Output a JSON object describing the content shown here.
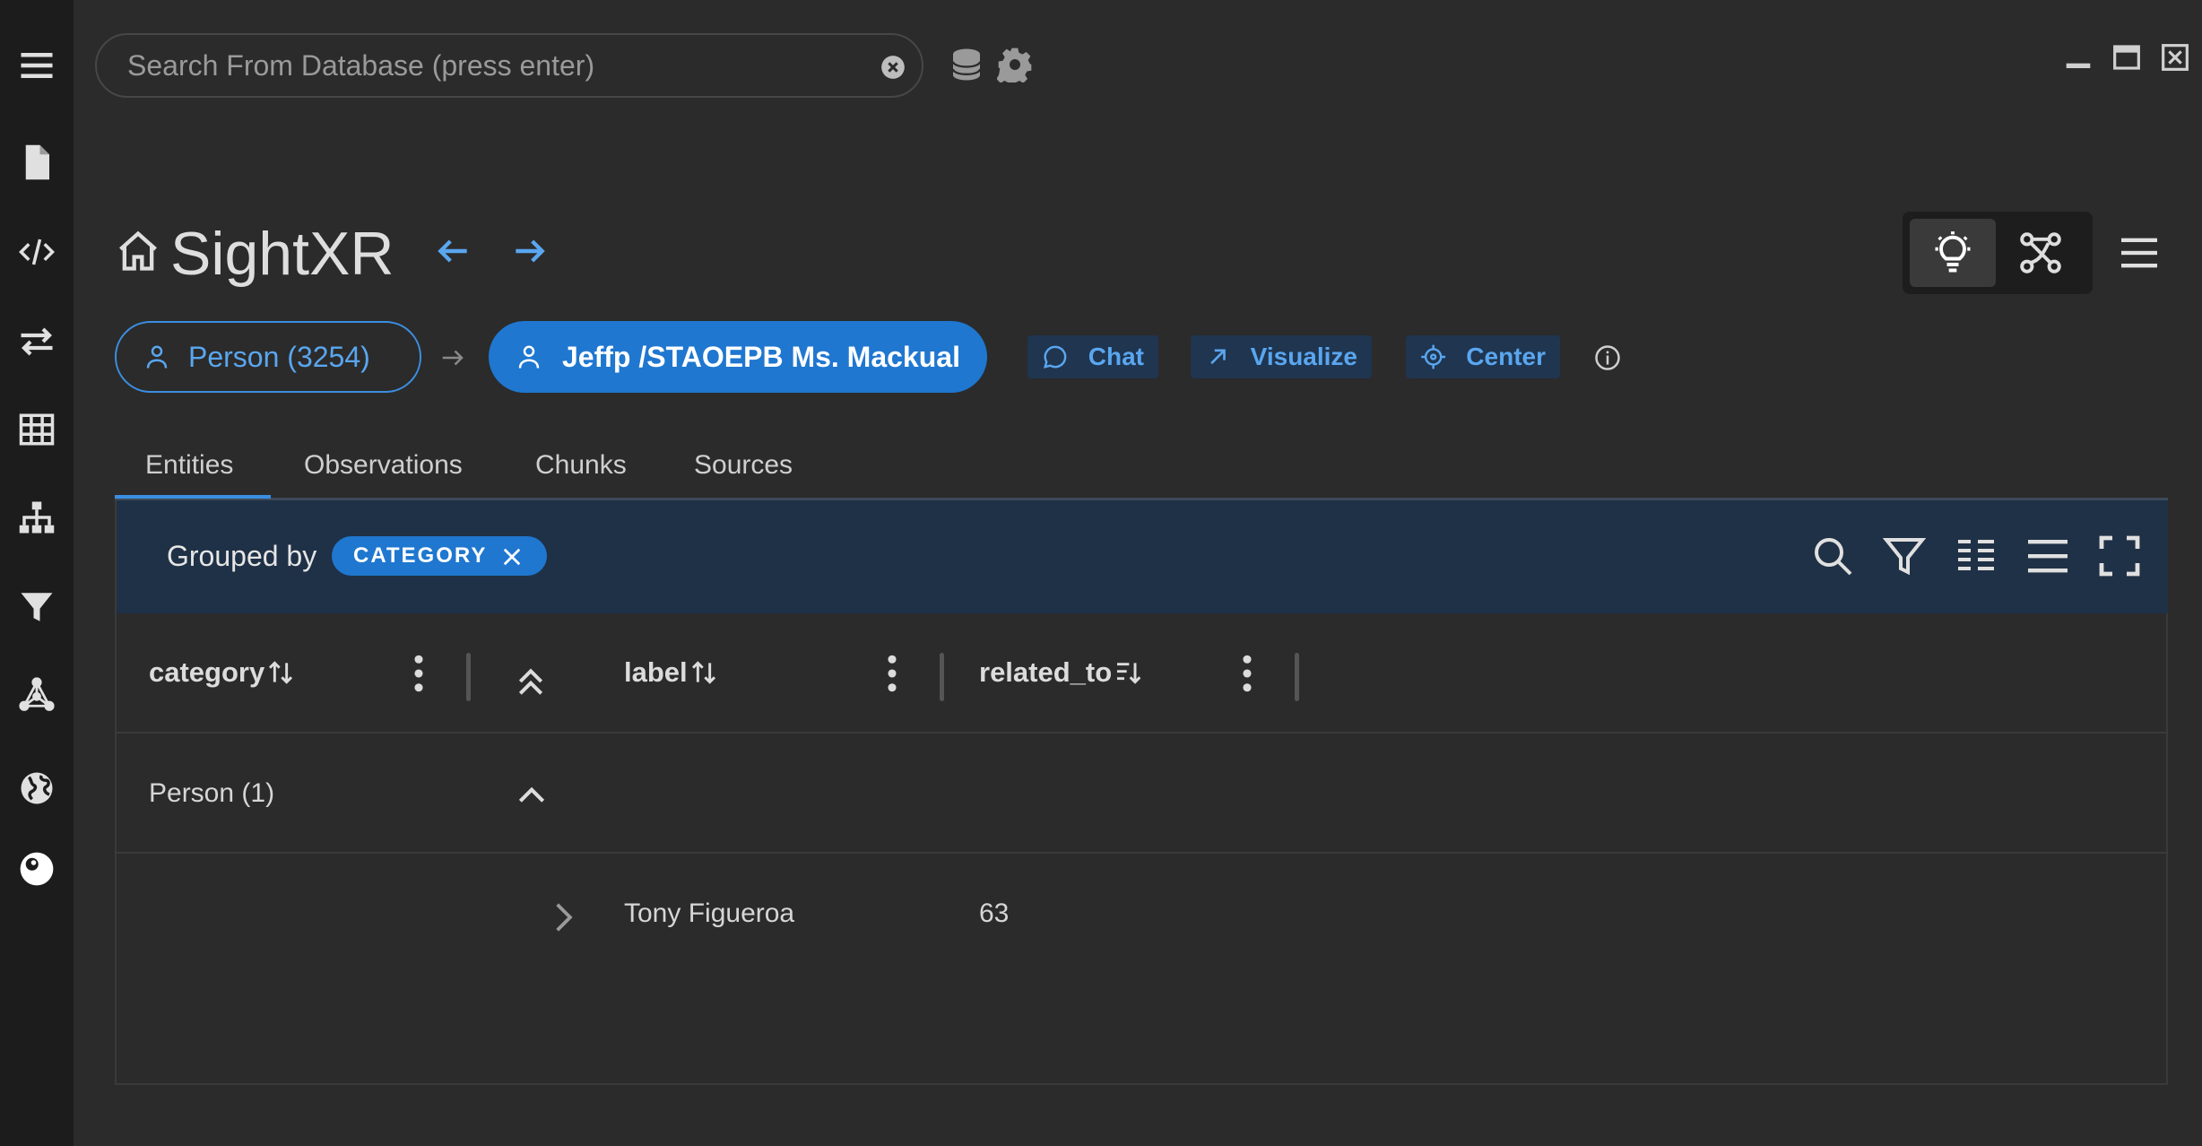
{
  "search": {
    "placeholder": "Search From Database (press enter)"
  },
  "header": {
    "title": "SightXR"
  },
  "breadcrumb": {
    "type_chip": "Person (3254)",
    "entity_chip": "Jeffp /STAOEPB Ms. Mackual"
  },
  "actions": {
    "chat": "Chat",
    "visualize": "Visualize",
    "center": "Center"
  },
  "tabs": [
    {
      "label": "Entities",
      "active": true
    },
    {
      "label": "Observations"
    },
    {
      "label": "Chunks"
    },
    {
      "label": "Sources"
    }
  ],
  "grouping": {
    "label": "Grouped by",
    "chip": "CATEGORY"
  },
  "table": {
    "columns": [
      {
        "label": "category"
      },
      {
        "label": "label"
      },
      {
        "label": "related_to"
      }
    ],
    "groups": [
      {
        "label": "Person (1)",
        "rows": [
          {
            "label": "Tony Figueroa",
            "related_to": "63"
          }
        ]
      }
    ]
  },
  "icons": {
    "sidebar": [
      "menu-icon",
      "file-icon",
      "code-icon",
      "transfer-icon",
      "table-icon",
      "hierarchy-icon",
      "filter-icon",
      "graph-icon",
      "globe-icon",
      "theme-icon"
    ],
    "top": [
      "database-icon",
      "gear-icon"
    ],
    "window": [
      "minimize-icon",
      "maximize-icon",
      "close-icon"
    ]
  },
  "colors": {
    "accent": "#1f77d0",
    "accent_text": "#5aa6ef",
    "sidebar_bg": "#1c1c1c",
    "bg": "#2b2b2b",
    "group_bar": "#1f3146"
  }
}
